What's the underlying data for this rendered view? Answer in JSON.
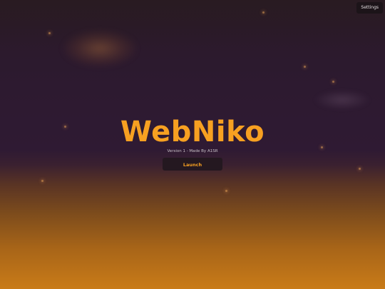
{
  "app": {
    "title": "WebNiko",
    "subtitle": "Version 1 - Made By A1SR"
  },
  "buttons": {
    "settings_label": "Settings",
    "launch_label": "Launch"
  },
  "colors": {
    "accent": "#f7a021",
    "background_top": "#2d1a30",
    "background_bottom": "#c97b18",
    "button_bg": "#241820"
  }
}
